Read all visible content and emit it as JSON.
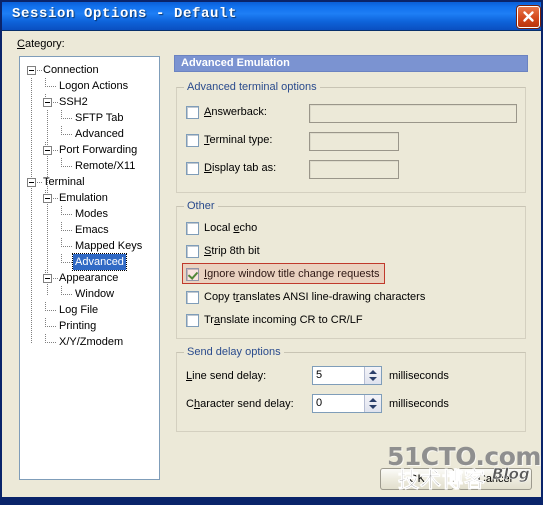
{
  "window": {
    "title": "Session Options - Default",
    "close_icon": "close-icon"
  },
  "sidebar": {
    "label": "Category:",
    "label_accel": "C",
    "tree": [
      {
        "label": "Connection",
        "depth": 0,
        "expandable": true,
        "selected": false
      },
      {
        "label": "Logon Actions",
        "depth": 1,
        "expandable": false,
        "selected": false
      },
      {
        "label": "SSH2",
        "depth": 1,
        "expandable": true,
        "selected": false
      },
      {
        "label": "SFTP Tab",
        "depth": 2,
        "expandable": false,
        "selected": false
      },
      {
        "label": "Advanced",
        "depth": 2,
        "expandable": false,
        "selected": false
      },
      {
        "label": "Port Forwarding",
        "depth": 1,
        "expandable": true,
        "selected": false
      },
      {
        "label": "Remote/X11",
        "depth": 2,
        "expandable": false,
        "selected": false
      },
      {
        "label": "Terminal",
        "depth": 0,
        "expandable": true,
        "selected": false
      },
      {
        "label": "Emulation",
        "depth": 1,
        "expandable": true,
        "selected": false
      },
      {
        "label": "Modes",
        "depth": 2,
        "expandable": false,
        "selected": false
      },
      {
        "label": "Emacs",
        "depth": 2,
        "expandable": false,
        "selected": false
      },
      {
        "label": "Mapped Keys",
        "depth": 2,
        "expandable": false,
        "selected": false
      },
      {
        "label": "Advanced",
        "depth": 2,
        "expandable": false,
        "selected": true
      },
      {
        "label": "Appearance",
        "depth": 1,
        "expandable": true,
        "selected": false
      },
      {
        "label": "Window",
        "depth": 2,
        "expandable": false,
        "selected": false
      },
      {
        "label": "Log File",
        "depth": 1,
        "expandable": false,
        "selected": false
      },
      {
        "label": "Printing",
        "depth": 1,
        "expandable": false,
        "selected": false
      },
      {
        "label": "X/Y/Zmodem",
        "depth": 1,
        "expandable": false,
        "selected": false
      }
    ]
  },
  "pane": {
    "header": "Advanced Emulation",
    "groups": {
      "advanced_terminal": {
        "title": "Advanced terminal options",
        "rows": [
          {
            "label": "Answerback:",
            "accel": "A",
            "checked": false,
            "value": ""
          },
          {
            "label": "Terminal type:",
            "accel": "T",
            "checked": false,
            "value": ""
          },
          {
            "label": "Display tab as:",
            "accel": "D",
            "checked": false,
            "value": ""
          }
        ]
      },
      "other": {
        "title": "Other",
        "checkboxes": [
          {
            "label": "Local echo",
            "accel": "e",
            "checked": false,
            "highlighted": false
          },
          {
            "label": "Strip 8th bit",
            "accel": "S",
            "checked": false,
            "highlighted": false
          },
          {
            "label": "Ignore window title change requests",
            "accel": "I",
            "checked": true,
            "highlighted": true
          },
          {
            "label": "Copy translates ANSI line-drawing characters",
            "accel": "r",
            "checked": false,
            "highlighted": false
          },
          {
            "label": "Translate incoming CR to CR/LF",
            "accel": "a",
            "checked": false,
            "highlighted": false
          }
        ]
      },
      "send_delay": {
        "title": "Send delay options",
        "rows": [
          {
            "label": "Line send delay:",
            "accel": "L",
            "value": "5",
            "unit": "milliseconds"
          },
          {
            "label": "Character send delay:",
            "accel": "h",
            "value": "0",
            "unit": "milliseconds"
          }
        ]
      }
    }
  },
  "footer": {
    "ok_label": "OK",
    "cancel_label": "Cancel"
  },
  "watermark": {
    "site": "51CTO.com",
    "cn": "技术博客",
    "blog": "Blog"
  },
  "colors": {
    "titlebar": "#0a5fd8",
    "dialog_face": "#ece9d8",
    "pane_header": "#7b93d1",
    "selection": "#316ac5",
    "highlight_border": "#c0392b",
    "group_title_text": "#2a4b8d"
  }
}
